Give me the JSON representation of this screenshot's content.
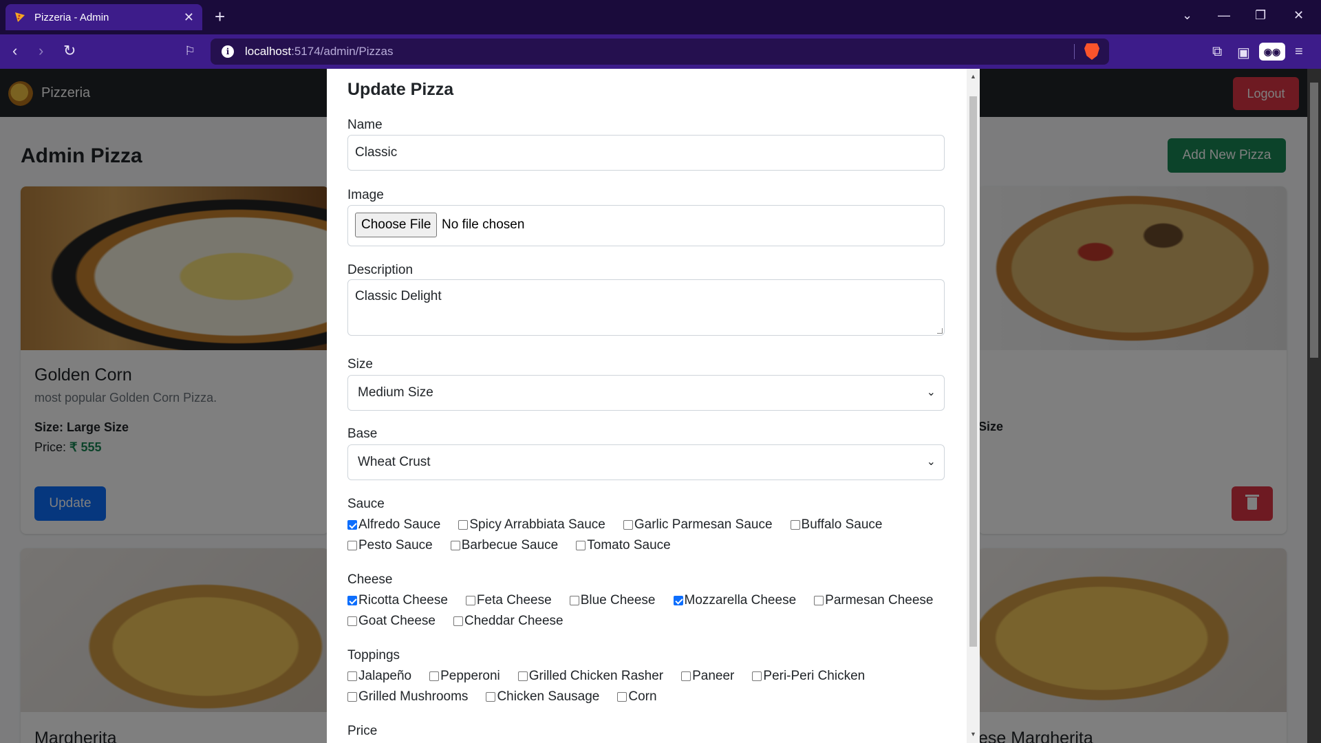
{
  "browser": {
    "tab_title": "Pizzeria - Admin",
    "tab_close": "✕",
    "new_tab": "+",
    "url_host": "localhost",
    "url_path": ":5174/admin/Pizzas"
  },
  "app": {
    "brand": "Pizzeria",
    "logout_label": "Logout",
    "page_title": "Admin Pizza",
    "add_label": "Add New Pizza"
  },
  "cards": [
    {
      "name": "Golden Corn",
      "description": "most popular Golden Corn Pizza.",
      "size": "Size: Large Size",
      "price_label": "Price: ",
      "price": "₹ 555",
      "update_label": "Update"
    },
    {
      "size_fragment": "Size"
    },
    {
      "name": "Margherita"
    },
    {
      "name_fragment": "ese Margherita"
    }
  ],
  "modal": {
    "title": "Update Pizza",
    "name_label": "Name",
    "name_value": "Classic",
    "image_label": "Image",
    "file_button": "Choose File",
    "file_status": "No file chosen",
    "description_label": "Description",
    "description_value": "Classic Delight",
    "size_label": "Size",
    "size_value": "Medium Size",
    "base_label": "Base",
    "base_value": "Wheat Crust",
    "sauce_label": "Sauce",
    "sauces": [
      {
        "label": "Alfredo Sauce",
        "checked": true
      },
      {
        "label": "Spicy Arrabbiata Sauce",
        "checked": false
      },
      {
        "label": "Garlic Parmesan Sauce",
        "checked": false
      },
      {
        "label": "Buffalo Sauce",
        "checked": false
      },
      {
        "label": "Pesto Sauce",
        "checked": false
      },
      {
        "label": "Barbecue Sauce",
        "checked": false
      },
      {
        "label": "Tomato Sauce",
        "checked": false
      }
    ],
    "cheese_label": "Cheese",
    "cheeses": [
      {
        "label": "Ricotta Cheese",
        "checked": true
      },
      {
        "label": "Feta Cheese",
        "checked": false
      },
      {
        "label": "Blue Cheese",
        "checked": false
      },
      {
        "label": "Mozzarella Cheese",
        "checked": true
      },
      {
        "label": "Parmesan Cheese",
        "checked": false
      },
      {
        "label": "Goat Cheese",
        "checked": false
      },
      {
        "label": "Cheddar Cheese",
        "checked": false
      }
    ],
    "toppings_label": "Toppings",
    "toppings": [
      {
        "label": "Jalapeño",
        "checked": false
      },
      {
        "label": "Pepperoni",
        "checked": false
      },
      {
        "label": "Grilled Chicken Rasher",
        "checked": false
      },
      {
        "label": "Paneer",
        "checked": false
      },
      {
        "label": "Peri-Peri Chicken",
        "checked": false
      },
      {
        "label": "Grilled Mushrooms",
        "checked": false
      },
      {
        "label": "Chicken Sausage",
        "checked": false
      },
      {
        "label": "Corn",
        "checked": false
      }
    ],
    "price_label": "Price"
  },
  "colors": {
    "browser_bg": "#1a0b3b",
    "browser_toolbar": "#3d1c8a",
    "primary": "#0d6efd",
    "success": "#198754",
    "danger": "#dc3545"
  }
}
